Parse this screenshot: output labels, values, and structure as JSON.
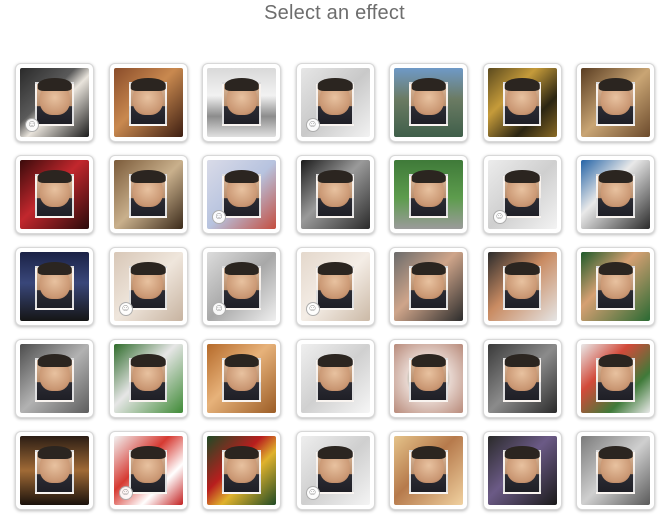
{
  "header": {
    "title": "Select an effect"
  },
  "effects": [
    {
      "id": "bride",
      "bg": "linear-gradient(135deg,#2a2a2a 0%,#5a5a5a 40%,#e9e4dc 55%,#1b1b1b 100%)",
      "smiley": true
    },
    {
      "id": "billboard-girl",
      "bg": "linear-gradient(135deg,#8a4c2a 0%,#c9894f 45%,#3d1e12 100%)",
      "smiley": false
    },
    {
      "id": "car",
      "bg": "linear-gradient(180deg,#d9d9d9 0%,#f2f2f2 40%,#8c8c8c 70%,#e0e0e0 100%)",
      "smiley": false
    },
    {
      "id": "pencil-sketch",
      "bg": "linear-gradient(135deg,#e6e6e6 0%,#c9c9c9 50%,#f2f2f2 100%)",
      "smiley": true
    },
    {
      "id": "building",
      "bg": "linear-gradient(180deg,#6f9ac7 0%,#6b7b63 45%,#3f5f4a 100%)",
      "smiley": false
    },
    {
      "id": "gold-frame",
      "bg": "linear-gradient(135deg,#5b4a1e 0%,#c59b3a 35%,#2b2512 70%,#8a6b25 100%)",
      "smiley": false
    },
    {
      "id": "photos-table",
      "bg": "linear-gradient(135deg,#5a3d22 0%,#c9a574 50%,#6b4a2c 100%)",
      "smiley": false
    },
    {
      "id": "poker",
      "bg": "linear-gradient(135deg,#3a0b0b 0%,#c2272d 45%,#2a0a0a 100%)",
      "smiley": false
    },
    {
      "id": "painting",
      "bg": "linear-gradient(135deg,#7b5b3a 0%,#c9b08c 50%,#3b2a1a 100%)",
      "smiley": false
    },
    {
      "id": "superhero",
      "bg": "linear-gradient(135deg,#d9dbe8 0%,#b7c3df 50%,#c44d3f 100%)",
      "smiley": true
    },
    {
      "id": "mirror-bw",
      "bg": "linear-gradient(135deg,#1c1c1c 0%,#9a9a9a 45%,#2a2a2a 100%)",
      "smiley": false
    },
    {
      "id": "park-billboard",
      "bg": "linear-gradient(180deg,#3f7a39 0%,#5d9c4d 55%,#9b9b9b 100%)",
      "smiley": false
    },
    {
      "id": "sign-holder",
      "bg": "linear-gradient(135deg,#ececec 0%,#cfcfcf 50%,#f3f3f3 100%)",
      "smiley": true
    },
    {
      "id": "blue-poster",
      "bg": "linear-gradient(135deg,#2463a6 0%,#e9e9e9 40%,#2a2a2a 100%)",
      "smiley": false
    },
    {
      "id": "night-billboard",
      "bg": "linear-gradient(180deg,#1b2246 0%,#39477a 45%,#151515 100%)",
      "smiley": false
    },
    {
      "id": "tattoo",
      "bg": "linear-gradient(135deg,#d8c7b7 0%,#efe6dc 50%,#c7b3a0 100%)",
      "smiley": true
    },
    {
      "id": "soldier-bw",
      "bg": "linear-gradient(135deg,#dcdcdc 0%,#a8a8a8 50%,#efefef 100%)",
      "smiley": true
    },
    {
      "id": "paper-hand",
      "bg": "linear-gradient(135deg,#e4d8cc 0%,#f4ede6 50%,#cbb9a6 100%)",
      "smiley": true
    },
    {
      "id": "girl-card",
      "bg": "linear-gradient(135deg,#6b6b6b 0%,#cfa58a 45%,#2c2c2c 100%)",
      "smiley": false
    },
    {
      "id": "face-paint",
      "bg": "linear-gradient(135deg,#2c2c2c 0%,#c98b62 45%,#e5e5e5 100%)",
      "smiley": false
    },
    {
      "id": "photo-strips",
      "bg": "linear-gradient(135deg,#1e5a2a 0%,#d6a073 40%,#2a6a33 100%)",
      "smiley": false
    },
    {
      "id": "street-couple",
      "bg": "linear-gradient(135deg,#4d4d4d 0%,#b2b2b2 50%,#5d5d5d 100%)",
      "smiley": false
    },
    {
      "id": "girl-shirt",
      "bg": "linear-gradient(135deg,#2e6b2a 0%,#e6e6e6 45%,#3f8a36 100%)",
      "smiley": false
    },
    {
      "id": "cat-frame",
      "bg": "linear-gradient(135deg,#b56a2a 0%,#e7b27a 45%,#9b5c25 100%)",
      "smiley": false
    },
    {
      "id": "drawing",
      "bg": "linear-gradient(135deg,#efefef 0%,#d0d0d0 50%,#f6f6f6 100%)",
      "smiley": false
    },
    {
      "id": "eye",
      "bg": "radial-gradient(circle at 50% 50%,#2d3b2f 0%,#6e8f7a 25%,#e7d6cf 45%,#b88a7a 100%)",
      "smiley": false
    },
    {
      "id": "crowd",
      "bg": "linear-gradient(135deg,#3a3a3a 0%,#8b8b8b 50%,#2a2a2a 100%)",
      "smiley": false
    },
    {
      "id": "collage",
      "bg": "linear-gradient(135deg,#e9e9e9 0%,#d24a3a 35%,#3f7a39 70%,#e9e9e9 100%)",
      "smiley": false
    },
    {
      "id": "old-street",
      "bg": "linear-gradient(180deg,#2b1d14 0%,#a06a36 50%,#1b120c 100%)",
      "smiley": false
    },
    {
      "id": "santa",
      "bg": "linear-gradient(135deg,#f2f2f2 0%,#d63a32 40%,#ffffff 70%,#c21f1f 100%)",
      "smiley": true
    },
    {
      "id": "xmas-ball",
      "bg": "linear-gradient(135deg,#1f4a25 0%,#b81e1e 40%,#e0b22c 60%,#1f4a25 100%)",
      "smiley": false
    },
    {
      "id": "couple-sketch",
      "bg": "linear-gradient(135deg,#eeeeee 0%,#cfcfcf 50%,#f4f4f4 100%)",
      "smiley": true
    },
    {
      "id": "blonde-card",
      "bg": "linear-gradient(135deg,#e5c38a 0%,#b67a4c 45%,#f0d1a0 100%)",
      "smiley": false
    },
    {
      "id": "laptop",
      "bg": "linear-gradient(135deg,#2a2a2a 0%,#6b5a86 45%,#1a1a1a 100%)",
      "smiley": false
    },
    {
      "id": "wall-poster",
      "bg": "linear-gradient(135deg,#7b7b7b 0%,#cfcfcf 50%,#5a5a5a 100%)",
      "smiley": false
    }
  ]
}
